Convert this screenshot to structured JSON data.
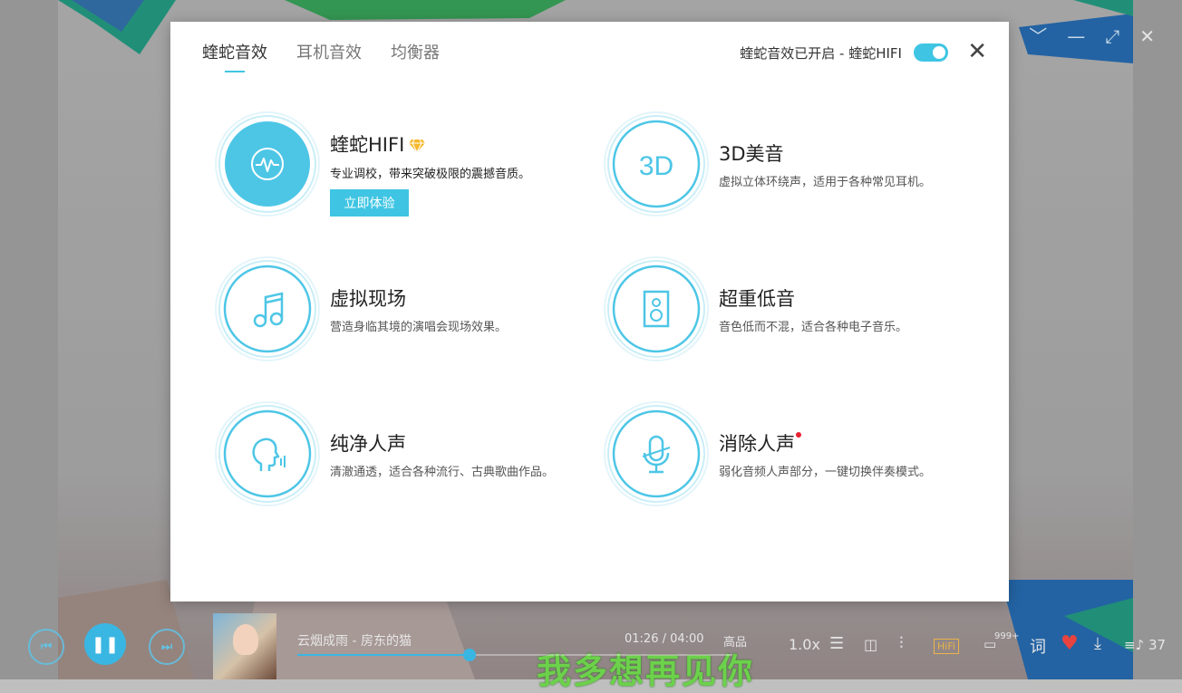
{
  "window_controls": {
    "collapse": "﹀",
    "minimize": "—",
    "fullscreen": "⤢",
    "close": "✕"
  },
  "dialog": {
    "tabs": [
      {
        "label": "蝰蛇音效",
        "active": true
      },
      {
        "label": "耳机音效",
        "active": false
      },
      {
        "label": "均衡器",
        "active": false
      }
    ],
    "status_text": "蝰蛇音效已开启 - 蝰蛇HIFI",
    "toggle_on": true,
    "close_glyph": "✕",
    "features": [
      {
        "title": "蝰蛇HIFI",
        "desc": "专业调校，带来突破极限的震撼音质。",
        "button": "立即体验",
        "icon": "waveform-icon",
        "badge": "diamond-vip-icon"
      },
      {
        "title": "3D美音",
        "desc": "虚拟立体环绕声，适用于各种常见耳机。",
        "icon": "3d-icon",
        "icon_text": "3D"
      },
      {
        "title": "虚拟现场",
        "desc": "营造身临其境的演唱会现场效果。",
        "icon": "music-note-icon"
      },
      {
        "title": "超重低音",
        "desc": "音色低而不混，适合各种电子音乐。",
        "icon": "speaker-icon"
      },
      {
        "title": "纯净人声",
        "desc": "清澈通透，适合各种流行、古典歌曲作品。",
        "icon": "voice-head-icon"
      },
      {
        "title": "消除人声",
        "desc": "弱化音频人声部分，一键切换伴奏模式。",
        "icon": "microphone-icon",
        "new_dot": true
      }
    ],
    "accent_color": "#3fc5e3"
  },
  "player": {
    "song": "云烟成雨 - 房东的猫",
    "time": "01:26 / 04:00",
    "quality": "高品",
    "progress": 0.395,
    "speed": "1.0x",
    "comment_count": "999+",
    "lyrics_btn": "词",
    "queue_count": "37",
    "hifi_label": "HiFi",
    "lyric_line": "我多想再见你"
  }
}
